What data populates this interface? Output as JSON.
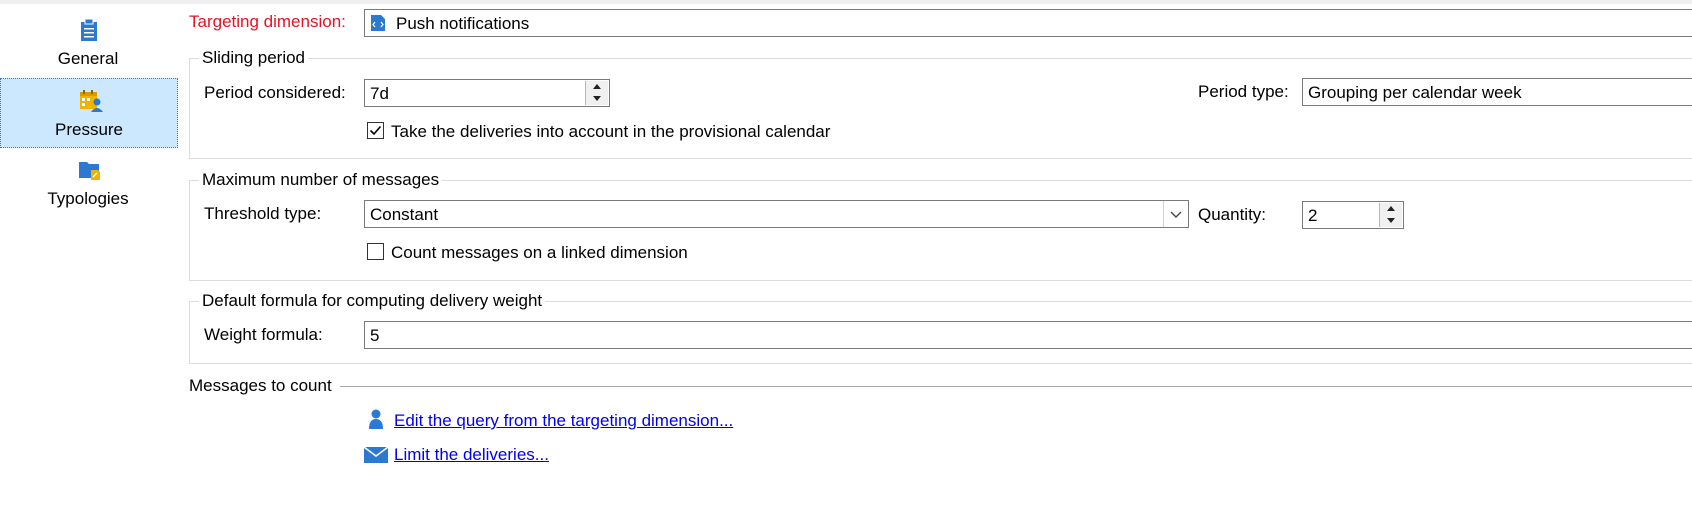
{
  "sidebar": {
    "items": [
      {
        "label": "General",
        "icon": "clipboard-icon"
      },
      {
        "label": "Pressure",
        "icon": "calendar-user-icon",
        "selected": true
      },
      {
        "label": "Typologies",
        "icon": "folder-typology-icon"
      }
    ]
  },
  "targeting": {
    "label": "Targeting dimension:",
    "value": "Push notifications",
    "label_color": "#e81123"
  },
  "sliding_period": {
    "legend": "Sliding period",
    "period_considered_label": "Period considered:",
    "period_considered_value": "7d",
    "period_type_label": "Period type:",
    "period_type_value": "Grouping per calendar week",
    "provisional_checkbox_label": "Take the deliveries into account in the provisional calendar",
    "provisional_checked": true
  },
  "max_messages": {
    "legend": "Maximum number of messages",
    "threshold_type_label": "Threshold type:",
    "threshold_type_value": "Constant",
    "quantity_label": "Quantity:",
    "quantity_value": "2",
    "linked_checkbox_label": "Count messages on a linked dimension",
    "linked_checked": false
  },
  "weight": {
    "legend": "Default formula for computing delivery weight",
    "formula_label": "Weight formula:",
    "formula_value": "5"
  },
  "messages_to_count": {
    "legend": "Messages to count",
    "edit_query_link": "Edit the query from the targeting dimension...",
    "limit_deliveries_link": "Limit the deliveries..."
  },
  "colors": {
    "selected_bg": "#cce8ff",
    "link": "#0000ee",
    "icon_blue": "#2b79d1",
    "icon_yellow": "#f0b400"
  }
}
